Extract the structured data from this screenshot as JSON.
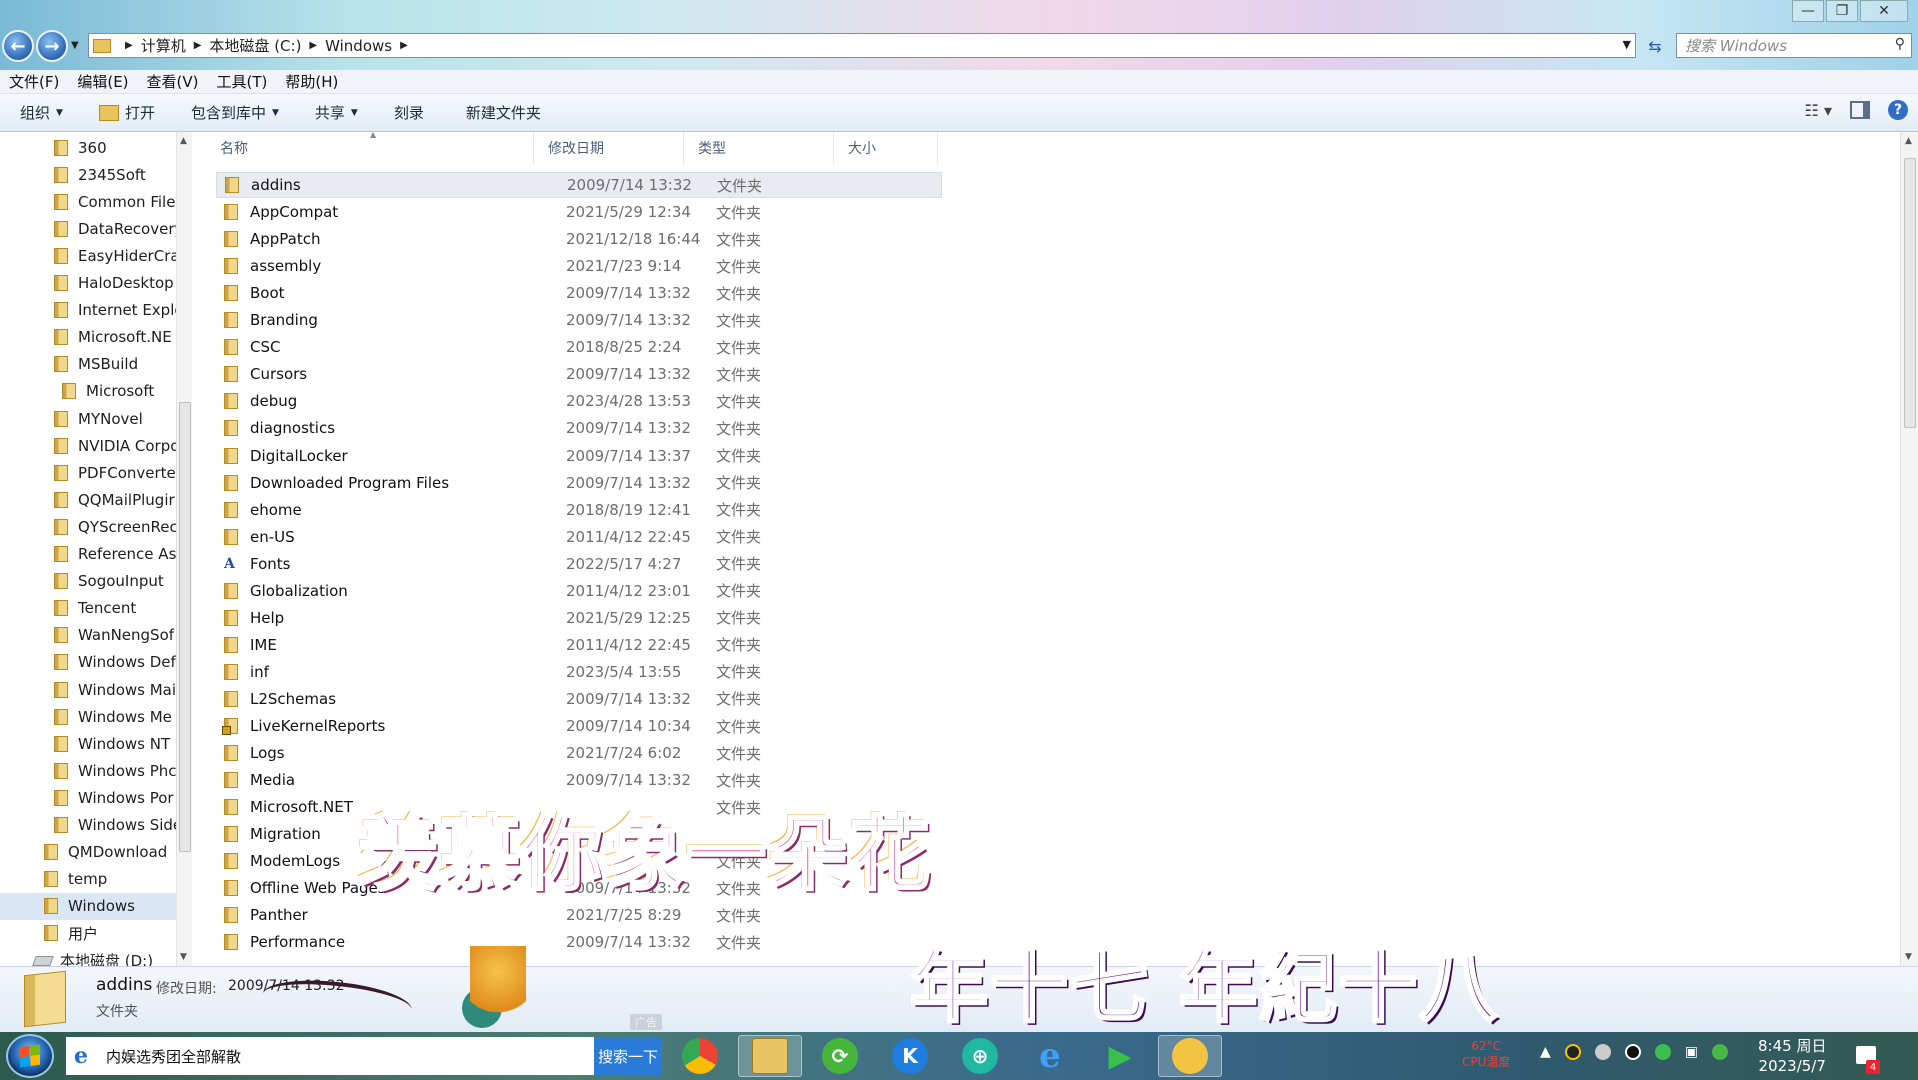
{
  "window": {
    "minimize": "—",
    "maximize": "❐",
    "close": "✕"
  },
  "address": {
    "crumbs": [
      "计算机",
      "本地磁盘 (C:)",
      "Windows"
    ],
    "search_placeholder": "搜索 Windows"
  },
  "menu": [
    "文件(F)",
    "编辑(E)",
    "查看(V)",
    "工具(T)",
    "帮助(H)"
  ],
  "toolbar": {
    "organize": "组织",
    "open": "打开",
    "include_library": "包含到库中",
    "share": "共享",
    "burn": "刻录",
    "new_folder": "新建文件夹"
  },
  "navpane": [
    {
      "label": "360",
      "indent": 1
    },
    {
      "label": "2345Soft",
      "indent": 1
    },
    {
      "label": "Common File",
      "indent": 1
    },
    {
      "label": "DataRecovery",
      "indent": 1
    },
    {
      "label": "EasyHiderCra",
      "indent": 1
    },
    {
      "label": "HaloDesktop",
      "indent": 1
    },
    {
      "label": "Internet Explo",
      "indent": 1
    },
    {
      "label": "Microsoft.NE",
      "indent": 1
    },
    {
      "label": "MSBuild",
      "indent": 1
    },
    {
      "label": "Microsoft",
      "indent": 2
    },
    {
      "label": "MYNovel",
      "indent": 1
    },
    {
      "label": "NVIDIA Corpo",
      "indent": 1
    },
    {
      "label": "PDFConverte",
      "indent": 1
    },
    {
      "label": "QQMailPlugir",
      "indent": 1
    },
    {
      "label": "QYScreenRec",
      "indent": 1
    },
    {
      "label": "Reference As",
      "indent": 1
    },
    {
      "label": "SogouInput",
      "indent": 1
    },
    {
      "label": "Tencent",
      "indent": 1
    },
    {
      "label": "WanNengSof",
      "indent": 1
    },
    {
      "label": "Windows Def",
      "indent": 1
    },
    {
      "label": "Windows Mai",
      "indent": 1
    },
    {
      "label": "Windows Me",
      "indent": 1
    },
    {
      "label": "Windows NT",
      "indent": 1
    },
    {
      "label": "Windows Phc",
      "indent": 1
    },
    {
      "label": "Windows Por",
      "indent": 1
    },
    {
      "label": "Windows Side",
      "indent": 1
    },
    {
      "label": "QMDownload",
      "indent": 0
    },
    {
      "label": "temp",
      "indent": 0
    },
    {
      "label": "Windows",
      "indent": 0,
      "selected": true
    },
    {
      "label": "用户",
      "indent": 0
    },
    {
      "label": "本地磁盘 (D:)",
      "indent": -1,
      "drive": true
    }
  ],
  "columns": {
    "name": "名称",
    "date": "修改日期",
    "type": "类型",
    "size": "大小"
  },
  "files": [
    {
      "name": "addins",
      "date": "2009/7/14 13:32",
      "type": "文件夹",
      "selected": true
    },
    {
      "name": "AppCompat",
      "date": "2021/5/29 12:34",
      "type": "文件夹"
    },
    {
      "name": "AppPatch",
      "date": "2021/12/18 16:44",
      "type": "文件夹"
    },
    {
      "name": "assembly",
      "date": "2021/7/23 9:14",
      "type": "文件夹"
    },
    {
      "name": "Boot",
      "date": "2009/7/14 13:32",
      "type": "文件夹"
    },
    {
      "name": "Branding",
      "date": "2009/7/14 13:32",
      "type": "文件夹"
    },
    {
      "name": "CSC",
      "date": "2018/8/25 2:24",
      "type": "文件夹"
    },
    {
      "name": "Cursors",
      "date": "2009/7/14 13:32",
      "type": "文件夹"
    },
    {
      "name": "debug",
      "date": "2023/4/28 13:53",
      "type": "文件夹"
    },
    {
      "name": "diagnostics",
      "date": "2009/7/14 13:32",
      "type": "文件夹"
    },
    {
      "name": "DigitalLocker",
      "date": "2009/7/14 13:37",
      "type": "文件夹"
    },
    {
      "name": "Downloaded Program Files",
      "date": "2009/7/14 13:32",
      "type": "文件夹"
    },
    {
      "name": "ehome",
      "date": "2018/8/19 12:41",
      "type": "文件夹"
    },
    {
      "name": "en-US",
      "date": "2011/4/12 22:45",
      "type": "文件夹"
    },
    {
      "name": "Fonts",
      "date": "2022/5/17 4:27",
      "type": "文件夹",
      "icon": "fonts"
    },
    {
      "name": "Globalization",
      "date": "2011/4/12 23:01",
      "type": "文件夹"
    },
    {
      "name": "Help",
      "date": "2021/5/29 12:25",
      "type": "文件夹"
    },
    {
      "name": "IME",
      "date": "2011/4/12 22:45",
      "type": "文件夹"
    },
    {
      "name": "inf",
      "date": "2023/5/4 13:55",
      "type": "文件夹"
    },
    {
      "name": "L2Schemas",
      "date": "2009/7/14 13:32",
      "type": "文件夹"
    },
    {
      "name": "LiveKernelReports",
      "date": "2009/7/14 10:34",
      "type": "文件夹",
      "icon": "locked"
    },
    {
      "name": "Logs",
      "date": "2021/7/24 6:02",
      "type": "文件夹"
    },
    {
      "name": "Media",
      "date": "2009/7/14 13:32",
      "type": "文件夹"
    },
    {
      "name": "Microsoft.NET",
      "date": "",
      "type": "文件夹"
    },
    {
      "name": "Migration",
      "date": "",
      "type": ""
    },
    {
      "name": "ModemLogs",
      "date": "",
      "type": "文件夹"
    },
    {
      "name": "Offline Web Pages",
      "date": "2009/7/14 13:32",
      "type": "文件夹"
    },
    {
      "name": "Panther",
      "date": "2021/7/25 8:29",
      "type": "文件夹"
    },
    {
      "name": "Performance",
      "date": "2009/7/14 13:32",
      "type": "文件夹"
    }
  ],
  "overlay": {
    "line1": "羡慕你象一朵花",
    "line2": "年十七 年紀十八"
  },
  "details": {
    "name": "addins",
    "date_label": "修改日期:",
    "date": "2009/7/14 13:32",
    "type": "文件夹",
    "ad_mark": "广告"
  },
  "taskbar": {
    "search_text": "内娱选秀团全部解散",
    "search_button": "搜索一下",
    "ie_glyph": "e",
    "cpu_temp": "62°C",
    "cpu_label": "CPU温度",
    "time": "8:45 周日",
    "date": "2023/5/7",
    "notif_count": "4"
  }
}
